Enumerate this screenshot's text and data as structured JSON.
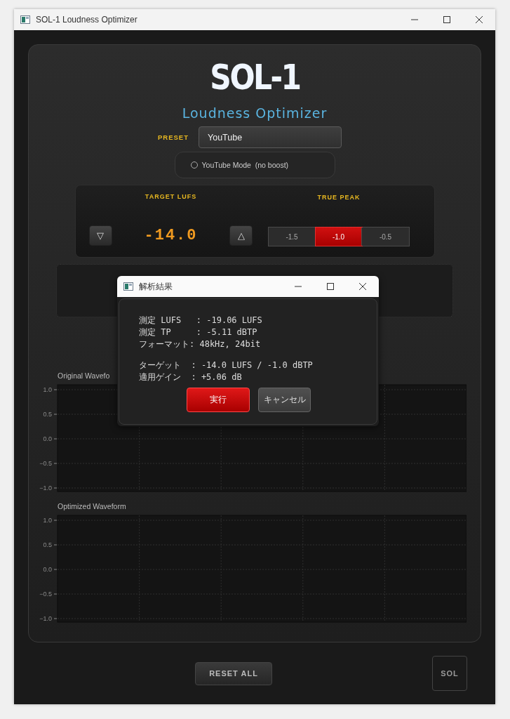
{
  "window": {
    "title": "SOL-1 Loudness Optimizer"
  },
  "header": {
    "logo": "SOL-1",
    "subtitle": "Loudness Optimizer"
  },
  "preset": {
    "label": "PRESET",
    "value": "YouTube"
  },
  "youtube_mode": {
    "label": "YouTube Mode  (no boost)",
    "checked": false
  },
  "target_lufs": {
    "label": "TARGET LUFS",
    "value": "-14.0",
    "down": "▽",
    "up": "△"
  },
  "true_peak": {
    "label": "TRUE PEAK",
    "options": [
      {
        "label": "-1.5",
        "selected": false
      },
      {
        "label": "-1.0",
        "selected": true
      },
      {
        "label": "-0.5",
        "selected": false
      }
    ]
  },
  "waveforms": [
    {
      "title": "Original Wavefo",
      "y_labels": [
        "1.0",
        "0.5",
        "0.0",
        "−0.5",
        "−1.0"
      ]
    },
    {
      "title": "Optimized Waveform",
      "y_labels": [
        "1.0",
        "0.5",
        "0.0",
        "−0.5",
        "−1.0"
      ]
    }
  ],
  "footer": {
    "reset_button": "RESET ALL",
    "badge": "SOL"
  },
  "dialog": {
    "title": "解析結果",
    "groups": [
      [
        "測定 LUFS   : -19.06 LUFS",
        "測定 TP     : -5.11 dBTP",
        "フォーマット: 48kHz, 24bit"
      ],
      [
        "ターゲット  : -14.0 LUFS / -1.0 dBTP",
        "適用ゲイン  : +5.06 dB"
      ]
    ],
    "ok": "実行",
    "cancel": "キャンセル"
  }
}
